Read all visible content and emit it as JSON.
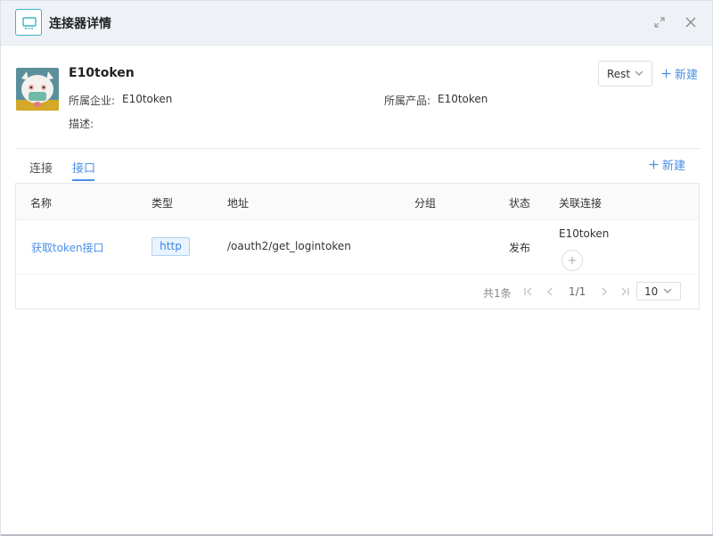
{
  "dialog": {
    "title": "连接器详情"
  },
  "connector": {
    "name": "E10token",
    "enterprise_label": "所属企业:",
    "enterprise_value": "E10token",
    "product_label": "所属产品:",
    "product_value": "E10token",
    "desc_label": "描述:",
    "type_select": "Rest",
    "new_label": "新建"
  },
  "tabs": [
    {
      "label": "连接",
      "active": false
    },
    {
      "label": "接口",
      "active": true
    }
  ],
  "tabs_new_label": "新建",
  "table": {
    "columns": [
      "名称",
      "类型",
      "地址",
      "分组",
      "状态",
      "关联连接"
    ],
    "rows": [
      {
        "name": "获取token接口",
        "type": "http",
        "address": "/oauth2/get_logintoken",
        "group": "",
        "status": "发布",
        "linked": "E10token"
      }
    ]
  },
  "pagination": {
    "total": "共1条",
    "page": "1/1",
    "page_size": "10"
  },
  "colors": {
    "accent": "#4a8fe7",
    "icon_teal": "#3bb4c8"
  },
  "icons": [
    "monitor-icon",
    "expand-icon",
    "close-icon",
    "chevron-down-icon",
    "plus-icon",
    "first-page-icon",
    "prev-page-icon",
    "next-page-icon",
    "last-page-icon"
  ]
}
